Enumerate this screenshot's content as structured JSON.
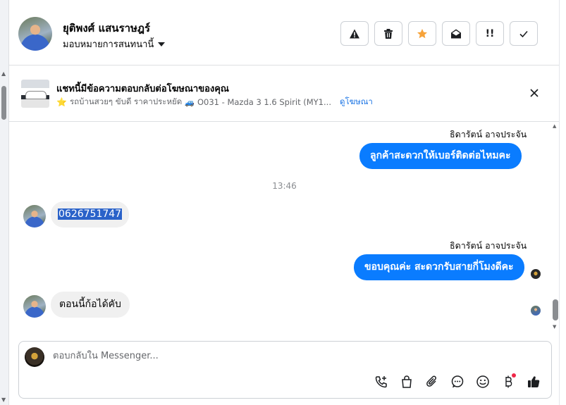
{
  "header": {
    "contact_name": "ยุติพงศ์ แสนราษฎร์",
    "assign_label": "มอบหมายการสนทนานี้",
    "actions": [
      {
        "name": "spam-button",
        "icon": "warning-icon"
      },
      {
        "name": "delete-button",
        "icon": "trash-icon"
      },
      {
        "name": "star-button",
        "icon": "star-icon"
      },
      {
        "name": "mark-unread-button",
        "icon": "envelope-open-icon"
      },
      {
        "name": "follow-up-button",
        "icon": "exclamation-icon"
      },
      {
        "name": "done-button",
        "icon": "check-icon"
      }
    ]
  },
  "ad": {
    "title": "แชทนี้มีข้อความตอบกลับต่อโฆษณาของคุณ",
    "star": "⭐",
    "description_1": "รถบ้านสวยๆ ขับดี ราคาประหยัด",
    "car": "🚙",
    "description_2": "O031 - Mazda 3 1.6 Spirit (MY1...",
    "link": "ดูโฆษณา"
  },
  "messages": {
    "sender_1": "ธิดารัตน์ อาจประจัน",
    "out_1": "ลูกค้าสะดวกให้เบอร์ติดต่อไหมคะ",
    "time_sep": "13:46",
    "in_1": "0626751747",
    "sender_2": "ธิดารัตน์ อาจประจัน",
    "out_2": "ขอบคุณค่ะ สะดวกรับสายกี่โมงดีคะ",
    "in_2": "ตอนนี้ก้อได้คับ"
  },
  "composer": {
    "placeholder": "ตอบกลับใน Messenger..."
  },
  "colors": {
    "accent": "#0a7cff",
    "star": "#f7a33a",
    "link": "#1b74e4",
    "notify": "#f02849"
  }
}
